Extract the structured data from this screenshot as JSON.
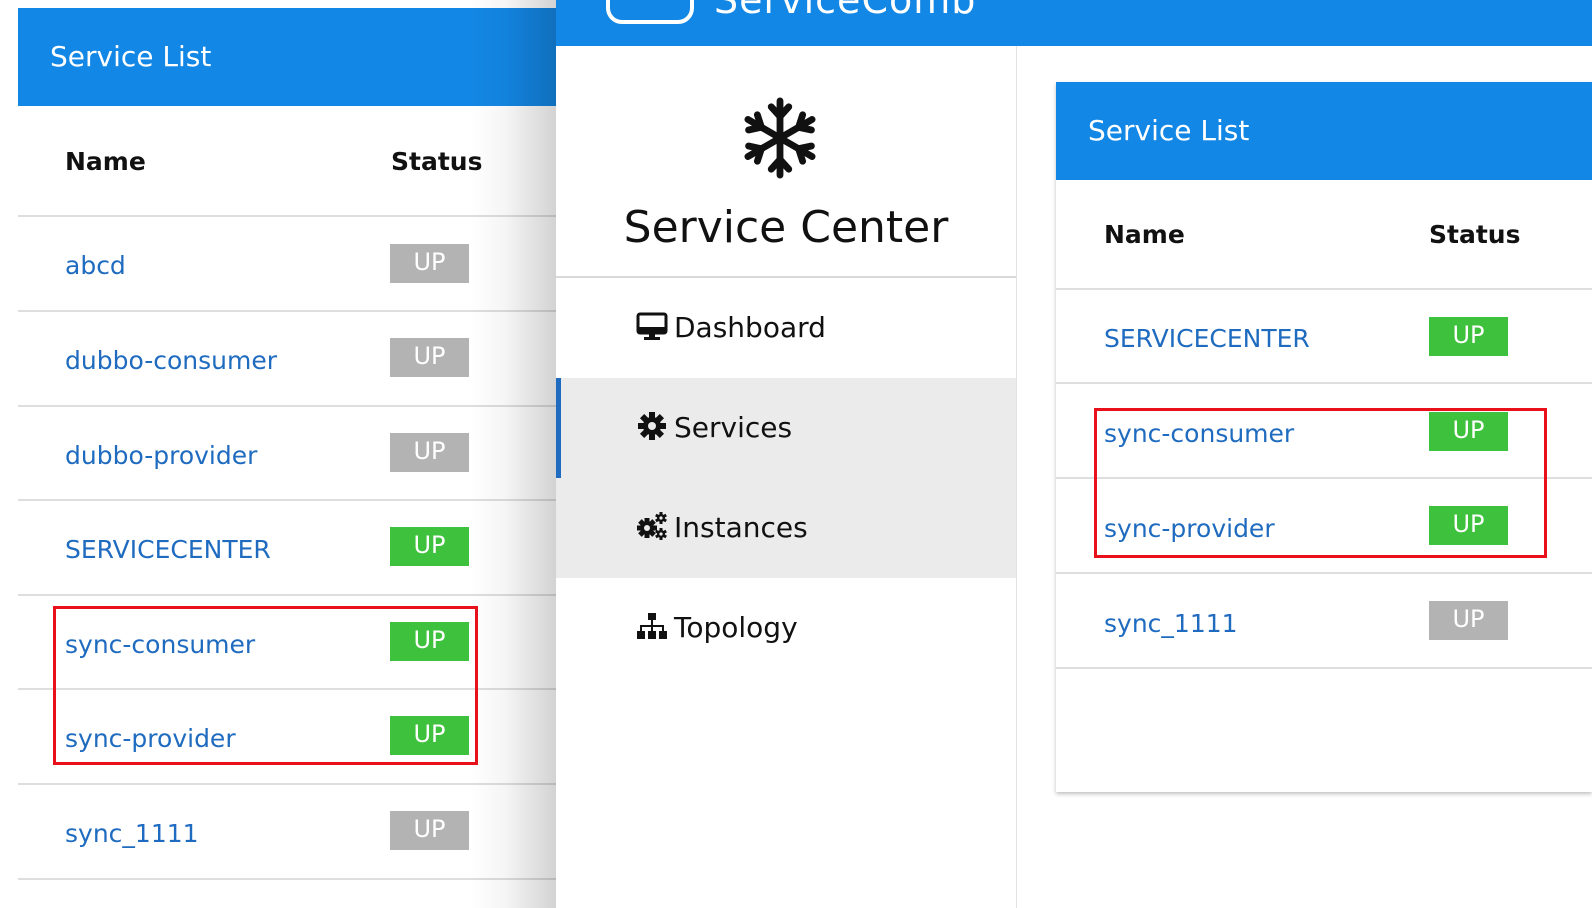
{
  "left_panel": {
    "title": "Service List",
    "columns": {
      "name": "Name",
      "status": "Status"
    },
    "rows": [
      {
        "name": "abcd",
        "status": "UP",
        "state": "inactive"
      },
      {
        "name": "dubbo-consumer",
        "status": "UP",
        "state": "inactive"
      },
      {
        "name": "dubbo-provider",
        "status": "UP",
        "state": "inactive"
      },
      {
        "name": "SERVICECENTER",
        "status": "UP",
        "state": "active"
      },
      {
        "name": "sync-consumer",
        "status": "UP",
        "state": "active"
      },
      {
        "name": "sync-provider",
        "status": "UP",
        "state": "active"
      },
      {
        "name": "sync_1111",
        "status": "UP",
        "state": "inactive"
      }
    ]
  },
  "app": {
    "brand": "ServiceComb",
    "sidebar": {
      "title": "Service Center",
      "logo_icon": "snowflake-icon",
      "items": [
        {
          "label": "Dashboard",
          "icon": "monitor-icon"
        },
        {
          "label": "Services",
          "icon": "gear-icon"
        },
        {
          "label": "Instances",
          "icon": "gears-icon"
        },
        {
          "label": "Topology",
          "icon": "sitemap-icon"
        }
      ]
    }
  },
  "right_panel": {
    "title": "Service List",
    "columns": {
      "name": "Name",
      "status": "Status"
    },
    "rows": [
      {
        "name": "SERVICECENTER",
        "status": "UP",
        "state": "active"
      },
      {
        "name": "sync-consumer",
        "status": "UP",
        "state": "active"
      },
      {
        "name": "sync-provider",
        "status": "UP",
        "state": "active"
      },
      {
        "name": "sync_1111",
        "status": "UP",
        "state": "inactive"
      }
    ]
  },
  "colors": {
    "header_blue": "#1387e5",
    "link_blue": "#1f6bbf",
    "status_up_active": "#3ec13c",
    "status_up_inactive": "#b3b3b3",
    "highlight_red": "#e8111b",
    "nav_active_bg": "#ebebeb"
  }
}
